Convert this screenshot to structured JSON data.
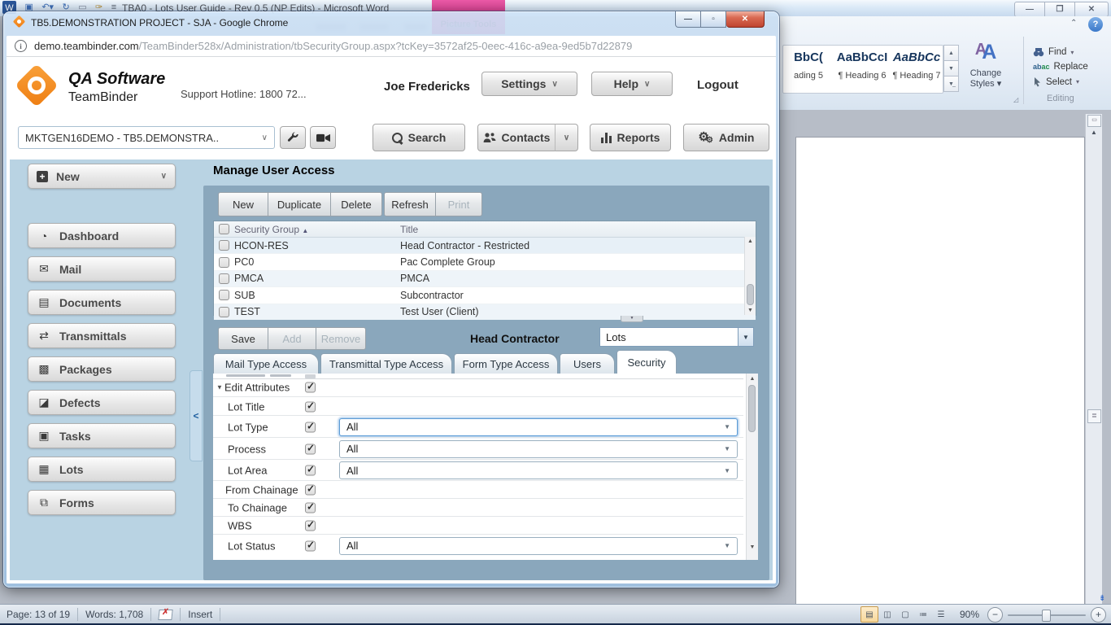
{
  "word": {
    "title": "TBA0 - Lots User Guide - Rev 0.5 (NP Edits) - Microsoft Word",
    "picture_tools": "Picture Tools",
    "ribbon": {
      "styles": [
        {
          "sample": "BbC(",
          "label": "ading 5"
        },
        {
          "sample": "AaBbCcI",
          "label": "¶ Heading 6"
        },
        {
          "sample": "AaBbCc",
          "label": "¶ Heading 7"
        }
      ],
      "change_line1": "Change",
      "change_line2": "Styles",
      "find": "Find",
      "replace": "Replace",
      "select": "Select",
      "editing_group": "Editing"
    },
    "status": {
      "page": "Page: 13 of 19",
      "words": "Words: 1,708",
      "insert_mode": "Insert",
      "zoom_level": "90%"
    }
  },
  "chrome": {
    "window_title": "TB5.DEMONSTRATION PROJECT - SJA - Google Chrome",
    "url_host": "demo.teambinder.com",
    "url_path": "/TeamBinder528x/Administration/tbSecurityGroup.aspx?tcKey=3572af25-0eec-416c-a9ea-9ed5b7d22879"
  },
  "header": {
    "brand_top": "QA Software",
    "brand_bottom": "TeamBinder",
    "support": "Support Hotline: 1800 72...",
    "user": "Joe Fredericks",
    "settings": "Settings",
    "help": "Help",
    "logout": "Logout"
  },
  "toolbar": {
    "project": "MKTGEN16DEMO - TB5.DEMONSTRA..",
    "search": "Search",
    "contacts": "Contacts",
    "reports": "Reports",
    "admin": "Admin"
  },
  "sidebar": {
    "new": "New",
    "items": [
      {
        "label": "Dashboard"
      },
      {
        "label": "Mail"
      },
      {
        "label": "Documents"
      },
      {
        "label": "Transmittals"
      },
      {
        "label": "Packages"
      },
      {
        "label": "Defects"
      },
      {
        "label": "Tasks"
      },
      {
        "label": "Lots"
      },
      {
        "label": "Forms"
      }
    ]
  },
  "main": {
    "title": "Manage User Access",
    "buttons": {
      "new": "New",
      "duplicate": "Duplicate",
      "delete": "Delete",
      "refresh": "Refresh",
      "print": "Print"
    },
    "grid": {
      "col_group": "Security Group",
      "col_title": "Title",
      "rows": [
        {
          "group": "HCON-RES",
          "title": "Head Contractor - Restricted"
        },
        {
          "group": "PC0",
          "title": "Pac Complete Group"
        },
        {
          "group": "PMCA",
          "title": "PMCA"
        },
        {
          "group": "SUB",
          "title": "Subcontractor"
        },
        {
          "group": "TEST",
          "title": "Test User (Client)"
        }
      ]
    },
    "detail": {
      "save": "Save",
      "add": "Add",
      "remove": "Remove",
      "group_title": "Head Contractor",
      "module": "Lots"
    },
    "tabs": [
      {
        "label": "Mail Type Access"
      },
      {
        "label": "Transmittal Type Access"
      },
      {
        "label": "Form Type Access"
      },
      {
        "label": "Users"
      },
      {
        "label": "Security"
      }
    ],
    "security": {
      "rows": [
        {
          "label": "Edit Attributes",
          "value": ""
        },
        {
          "label": "Lot Title",
          "value": ""
        },
        {
          "label": "Lot Type",
          "value": "All"
        },
        {
          "label": "Process",
          "value": "All"
        },
        {
          "label": "Lot Area",
          "value": "All"
        },
        {
          "label": "From Chainage",
          "value": ""
        },
        {
          "label": "To Chainage",
          "value": ""
        },
        {
          "label": "WBS",
          "value": ""
        },
        {
          "label": "Lot Status",
          "value": "All"
        }
      ]
    }
  }
}
